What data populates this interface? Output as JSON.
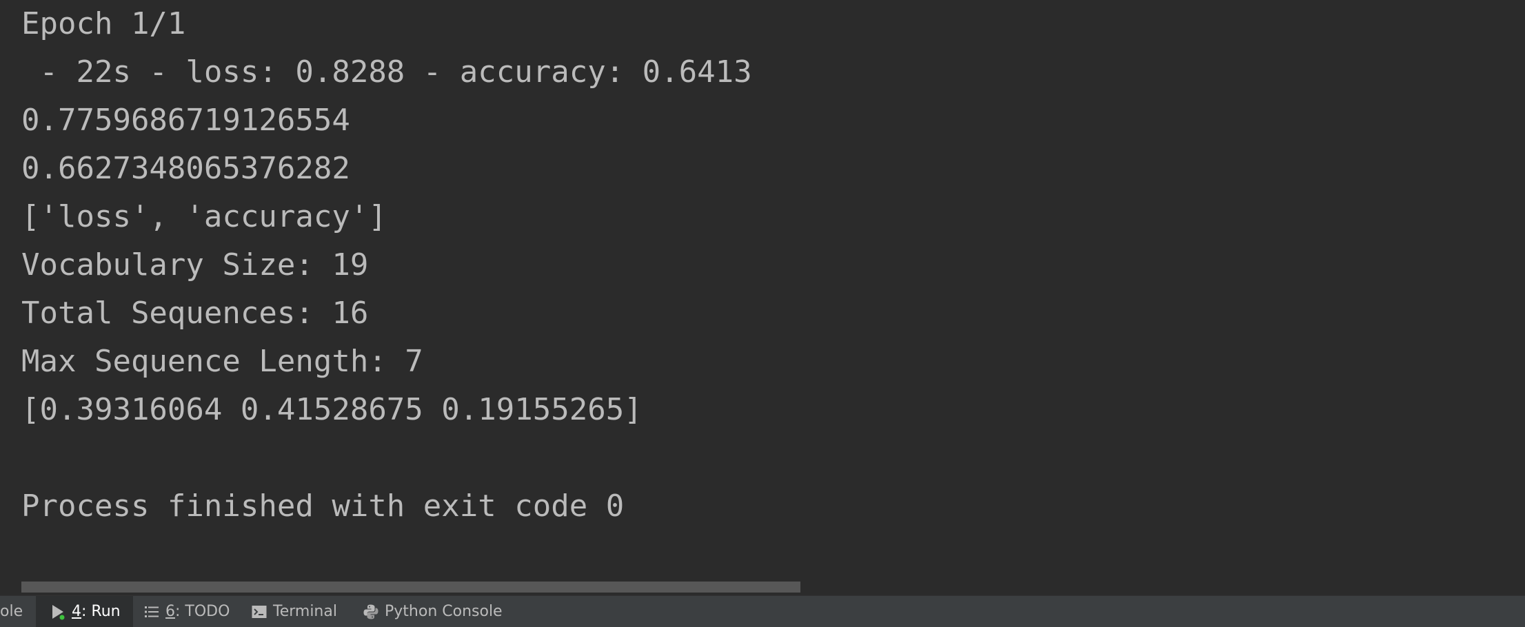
{
  "console": {
    "lines": [
      "Epoch 1/1",
      " - 22s - loss: 0.8288 - accuracy: 0.6413",
      "0.7759686719126554",
      "0.6627348065376282",
      "['loss', 'accuracy']",
      "Vocabulary Size: 19",
      "Total Sequences: 16",
      "Max Sequence Length: 7",
      "[0.39316064 0.41528675 0.19155265]",
      "",
      "Process finished with exit code 0"
    ]
  },
  "tool_tabs": {
    "console_partial": "ole",
    "run": {
      "number": "4",
      "label": ": Run",
      "running_indicator_color": "#3fc43f"
    },
    "todo": {
      "number": "6",
      "label": ": TODO"
    },
    "terminal": {
      "label": "Terminal"
    },
    "python_console": {
      "label": "Python Console"
    }
  },
  "colors": {
    "background": "#2b2b2b",
    "text": "#bbbbbb",
    "toolbar": "#3c3f41"
  }
}
